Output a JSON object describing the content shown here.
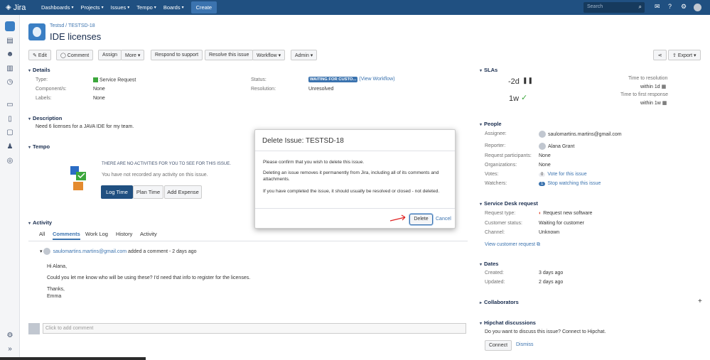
{
  "nav": {
    "logo": "Jira",
    "items": [
      "Dashboards",
      "Projects",
      "Issues",
      "Tempo",
      "Boards"
    ],
    "create": "Create",
    "search_placeholder": "Search"
  },
  "issue": {
    "project": "Testsd",
    "key": "TESTSD-18",
    "title": "IDE licenses"
  },
  "toolbar": {
    "edit": "Edit",
    "comment": "Comment",
    "assign": "Assign",
    "more": "More",
    "respond": "Respond to support",
    "resolve": "Resolve this issue",
    "workflow": "Workflow",
    "admin": "Admin",
    "export": "Export"
  },
  "details": {
    "heading": "Details",
    "type_label": "Type:",
    "type_value": "Service Request",
    "components_label": "Component/s:",
    "components_value": "None",
    "labels_label": "Labels:",
    "labels_value": "None",
    "status_label": "Status:",
    "status_value": "WAITING FOR CUSTO...",
    "view_workflow": "(View Workflow)",
    "resolution_label": "Resolution:",
    "resolution_value": "Unresolved"
  },
  "description": {
    "heading": "Description",
    "text": "Need 6 licenses for a JAVA IDE for my team."
  },
  "tempo": {
    "heading": "Tempo",
    "no_activities": "THERE ARE NO ACTIVITIES FOR YOU TO SEE FOR THIS ISSUE.",
    "not_recorded": "You have not recorded any activity on this issue.",
    "log_time": "Log Time",
    "plan_time": "Plan Time",
    "add_expense": "Add Expense"
  },
  "activity": {
    "heading": "Activity",
    "tabs": [
      "All",
      "Comments",
      "Work Log",
      "History",
      "Activity"
    ],
    "comment_author": "saulomartins.martins@gmail.com",
    "comment_meta": "added a comment - 2 days ago",
    "comment_lines": [
      "Hi Alana,",
      "Could you let me know who will be using these? I'd need that info to register for the licenses.",
      "Thanks,",
      "Emma"
    ],
    "add_comment_placeholder": "Click to add comment"
  },
  "slas": {
    "heading": "SLAs",
    "sla1_value": "-2d",
    "sla1_name": "Time to resolution",
    "sla1_goal": "within 1d",
    "sla2_value": "1w",
    "sla2_name": "Time to first response",
    "sla2_goal": "within 1w"
  },
  "people": {
    "heading": "People",
    "assignee_label": "Assignee:",
    "assignee_value": "saulomartins.martins@gmail.com",
    "reporter_label": "Reporter:",
    "reporter_value": "Alana Grant",
    "participants_label": "Request participants:",
    "participants_value": "None",
    "organizations_label": "Organizations:",
    "organizations_value": "None",
    "votes_label": "Votes:",
    "votes_count": "0",
    "votes_link": "Vote for this issue",
    "watchers_label": "Watchers:",
    "watchers_count": "1",
    "watchers_link": "Stop watching this issue"
  },
  "service_desk": {
    "heading": "Service Desk request",
    "request_type_label": "Request type:",
    "request_type_value": "Request new software",
    "customer_status_label": "Customer status:",
    "customer_status_value": "Waiting for customer",
    "channel_label": "Channel:",
    "channel_value": "Unknown",
    "view_request": "View customer request"
  },
  "dates": {
    "heading": "Dates",
    "created_label": "Created:",
    "created_value": "3 days ago",
    "updated_label": "Updated:",
    "updated_value": "2 days ago"
  },
  "collaborators": {
    "heading": "Collaborators"
  },
  "hipchat": {
    "heading": "Hipchat discussions",
    "text": "Do you want to discuss this issue? Connect to Hipchat.",
    "connect": "Connect",
    "dismiss": "Dismiss"
  },
  "dialog": {
    "title": "Delete Issue: TESTSD-18",
    "confirm": "Please confirm that you wish to delete this issue.",
    "warning": "Deleting an issue removes it permanently from Jira, including all of its comments and attachments.",
    "hint": "If you have completed the issue, it should usually be resolved or closed - not deleted.",
    "delete": "Delete",
    "cancel": "Cancel"
  },
  "colors": {
    "nav": "#205081",
    "link": "#3b73af",
    "annotation_arrow": "#e02020"
  }
}
